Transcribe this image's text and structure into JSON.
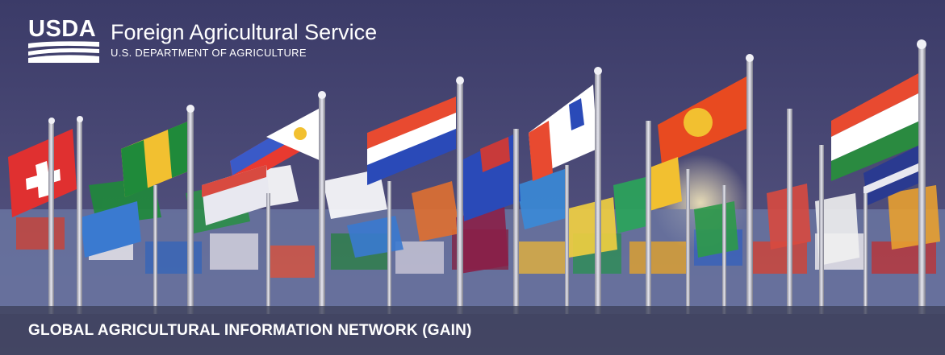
{
  "logo": {
    "mark_text": "USDA",
    "agency_name": "Foreign Agricultural Service",
    "department": "U.S. DEPARTMENT OF AGRICULTURE"
  },
  "banner": {
    "program_title": "GLOBAL AGRICULTURAL INFORMATION NETWORK (GAIN)",
    "background_description_icon": "world-flags-photo",
    "colors": {
      "sky": "#3a3a66",
      "band": "#3c405a",
      "text": "#ffffff"
    }
  }
}
